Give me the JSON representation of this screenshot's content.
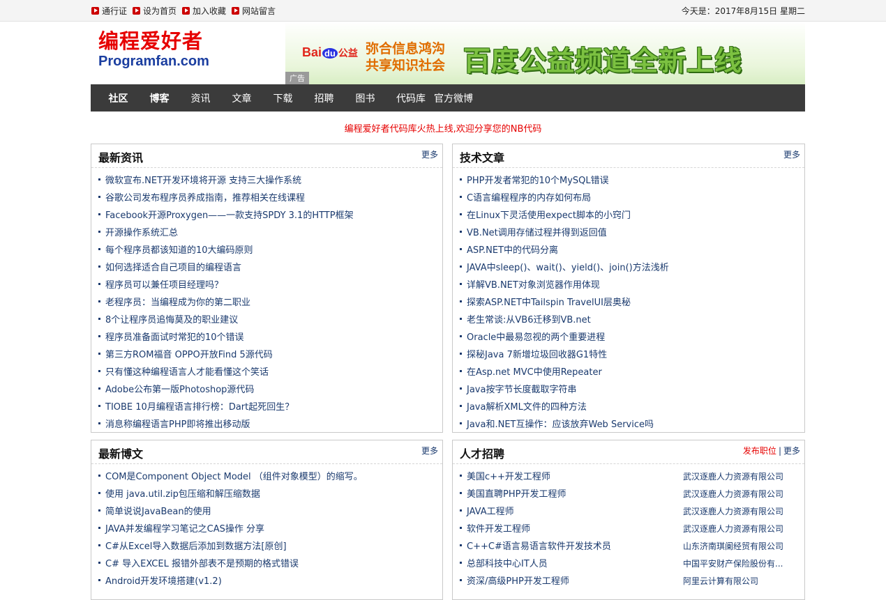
{
  "topbar": {
    "links": [
      "通行证",
      "设为首页",
      "加入收藏",
      "网站留言"
    ],
    "date": "今天是：2017年8月15日  星期二"
  },
  "logo": {
    "cn": "编程爱好者",
    "en": "Programfan.com"
  },
  "banner": {
    "baidu_brand": "Bai",
    "baidu_du": "du",
    "baidu_gongyi": "公益",
    "slogan_line1": "弥合信息鸿沟",
    "slogan_line2": "共享知识社会",
    "headline": "百度公益频道全新上线",
    "ad_label": "广告"
  },
  "nav": [
    "社区",
    "博客",
    "资讯",
    "文章",
    "下载",
    "招聘",
    "图书",
    "代码库",
    "官方微博"
  ],
  "notice": "编程爱好者代码库火热上线,欢迎分享您的NB代码",
  "news": {
    "title": "最新资讯",
    "more": "更多",
    "items": [
      "微软宣布.NET开发环境将开源 支持三大操作系统",
      "谷歌公司发布程序员养成指南，推荐相关在线课程",
      "Facebook开源Proxygen——一款支持SPDY 3.1的HTTP框架",
      "开源操作系统汇总",
      "每个程序员都该知道的10大编码原则",
      "如何选择适合自己项目的编程语言",
      "程序员可以兼任项目经理吗？",
      "老程序员：当编程成为你的第二职业",
      "8个让程序员追悔莫及的职业建议",
      "程序员准备面试时常犯的10个错误",
      "第三方ROM福音 OPPO开放Find 5源代码",
      "只有懂这种编程语言人才能看懂这个笑话",
      "Adobe公布第一版Photoshop源代码",
      "TIOBE 10月编程语言排行榜：Dart起死回生？",
      "消息称编程语言PHP即将推出移动版"
    ]
  },
  "articles": {
    "title": "技术文章",
    "more": "更多",
    "items": [
      "PHP开发者常犯的10个MySQL错误",
      "C语言编程程序的内存如何布局",
      "在Linux下灵活使用expect脚本的小窍门",
      "VB.Net调用存储过程并得到返回值",
      "ASP.NET中的代码分离",
      "JAVA中sleep()、wait()、yield()、join()方法浅析",
      "详解VB.NET对象浏览器作用体现",
      "探索ASP.NET中Tailspin TravelUI层奥秘",
      "老生常谈:从VB6迁移到VB.net",
      "Oracle中最易忽视的两个重要进程",
      "探秘Java 7新增垃圾回收器G1特性",
      "在Asp.net MVC中使用Repeater",
      "Java按字节长度截取字符串",
      "Java解析XML文件的四种方法",
      "Java和.NET互操作：应该放弃Web Service吗"
    ]
  },
  "blogs": {
    "title": "最新博文",
    "more": "更多",
    "items": [
      "COM是Component Object Model （组件对象模型）的缩写。",
      "使用 java.util.zip包压缩和解压缩数据",
      "简单说说JavaBean的使用",
      "JAVA并发编程学习笔记之CAS操作 分享",
      "C#从Excel导入数据后添加到数据方法[原创]",
      "C# 导入EXCEL 报错外部表不是预期的格式错误",
      "Android开发环境搭建(v1.2)"
    ]
  },
  "jobs": {
    "title": "人才招聘",
    "post": "发布职位",
    "sep": "|",
    "more": "更多",
    "items": [
      {
        "job": "美国c++开发工程师",
        "company": "武汉逐鹿人力资源有限公司"
      },
      {
        "job": "美国直聘PHP开发工程师",
        "company": "武汉逐鹿人力资源有限公司"
      },
      {
        "job": "JAVA工程师",
        "company": "武汉逐鹿人力资源有限公司"
      },
      {
        "job": "软件开发工程师",
        "company": "武汉逐鹿人力资源有限公司"
      },
      {
        "job": "C++C#语言易语言软件开发技术员",
        "company": "山东济南琪阑经贸有限公司"
      },
      {
        "job": "总部科技中心IT人员",
        "company": "中国平安财产保险股份有..."
      },
      {
        "job": "资深/高级PHP开发工程师",
        "company": "阿里云计算有限公司"
      }
    ]
  }
}
